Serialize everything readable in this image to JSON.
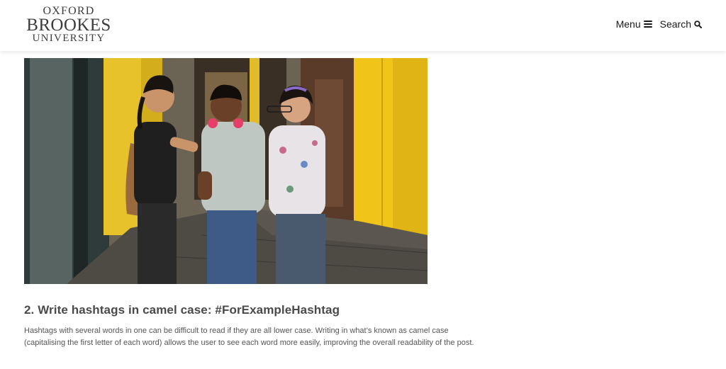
{
  "brand": {
    "line1": "OXFORD",
    "line2": "BROOKES",
    "line3": "UNIVERSITY"
  },
  "nav": {
    "menu_label": "Menu",
    "menu_icon": "hamburger-icon",
    "search_label": "Search",
    "search_icon": "magnifier-icon"
  },
  "article": {
    "heading": "2. Write hashtags in camel case: #ForExampleHashtag",
    "paragraph": "Hashtags with several words in one can be difficult to read if they are all lower case. Writing in what’s known as camel case (capitalising the first letter of each word) allows the user to see each word more easily, improving the overall readability of the post."
  },
  "colors": {
    "accent_yellow": "#f0c419",
    "text_dark": "#333333",
    "header_bg": "#ffffff"
  }
}
